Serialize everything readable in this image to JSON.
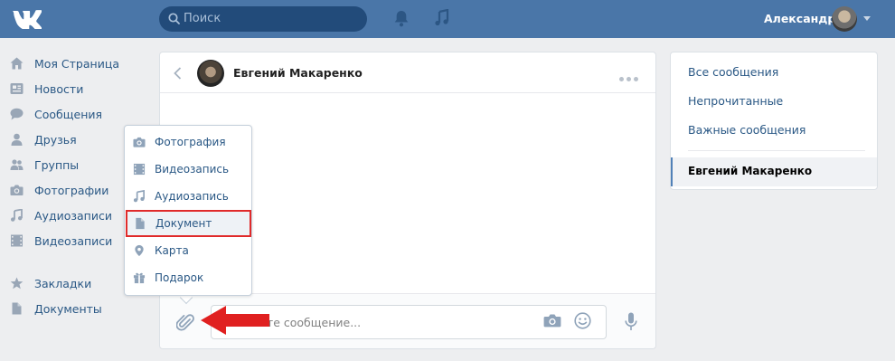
{
  "header": {
    "logo_icon": "vk-logo",
    "search_placeholder": "Поиск",
    "notifications_icon": "bell-icon",
    "music_icon": "music-icon",
    "user_name": "Александр"
  },
  "sidebar": {
    "items": [
      {
        "label": "Моя Страница",
        "icon": "home-icon"
      },
      {
        "label": "Новости",
        "icon": "news-icon"
      },
      {
        "label": "Сообщения",
        "icon": "messages-icon"
      },
      {
        "label": "Друзья",
        "icon": "friend-icon"
      },
      {
        "label": "Группы",
        "icon": "groups-icon"
      },
      {
        "label": "Фотографии",
        "icon": "camera-icon"
      },
      {
        "label": "Аудиозаписи",
        "icon": "music-note-icon"
      },
      {
        "label": "Видеозаписи",
        "icon": "film-icon"
      },
      {
        "label": "Закладки",
        "icon": "star-icon"
      },
      {
        "label": "Документы",
        "icon": "document-icon"
      }
    ]
  },
  "chat": {
    "contact_name": "Евгений Макаренко",
    "message_placeholder": "Напишите сообщение..."
  },
  "attach_menu": {
    "items": [
      {
        "label": "Фотография",
        "icon": "camera-icon"
      },
      {
        "label": "Видеозапись",
        "icon": "film-icon"
      },
      {
        "label": "Аудиозапись",
        "icon": "music-note-icon"
      },
      {
        "label": "Документ",
        "icon": "document-icon",
        "selected": true
      },
      {
        "label": "Карта",
        "icon": "map-pin-icon"
      },
      {
        "label": "Подарок",
        "icon": "gift-icon"
      }
    ]
  },
  "right_panel": {
    "filters": [
      {
        "label": "Все сообщения"
      },
      {
        "label": "Непрочитанные"
      },
      {
        "label": "Важные сообщения"
      }
    ],
    "active_dialog": "Евгений Макаренко"
  },
  "colors": {
    "header_bg": "#4a76a8",
    "link": "#2a5885",
    "highlight_border": "#e02a2a",
    "arrow": "#e02020"
  }
}
